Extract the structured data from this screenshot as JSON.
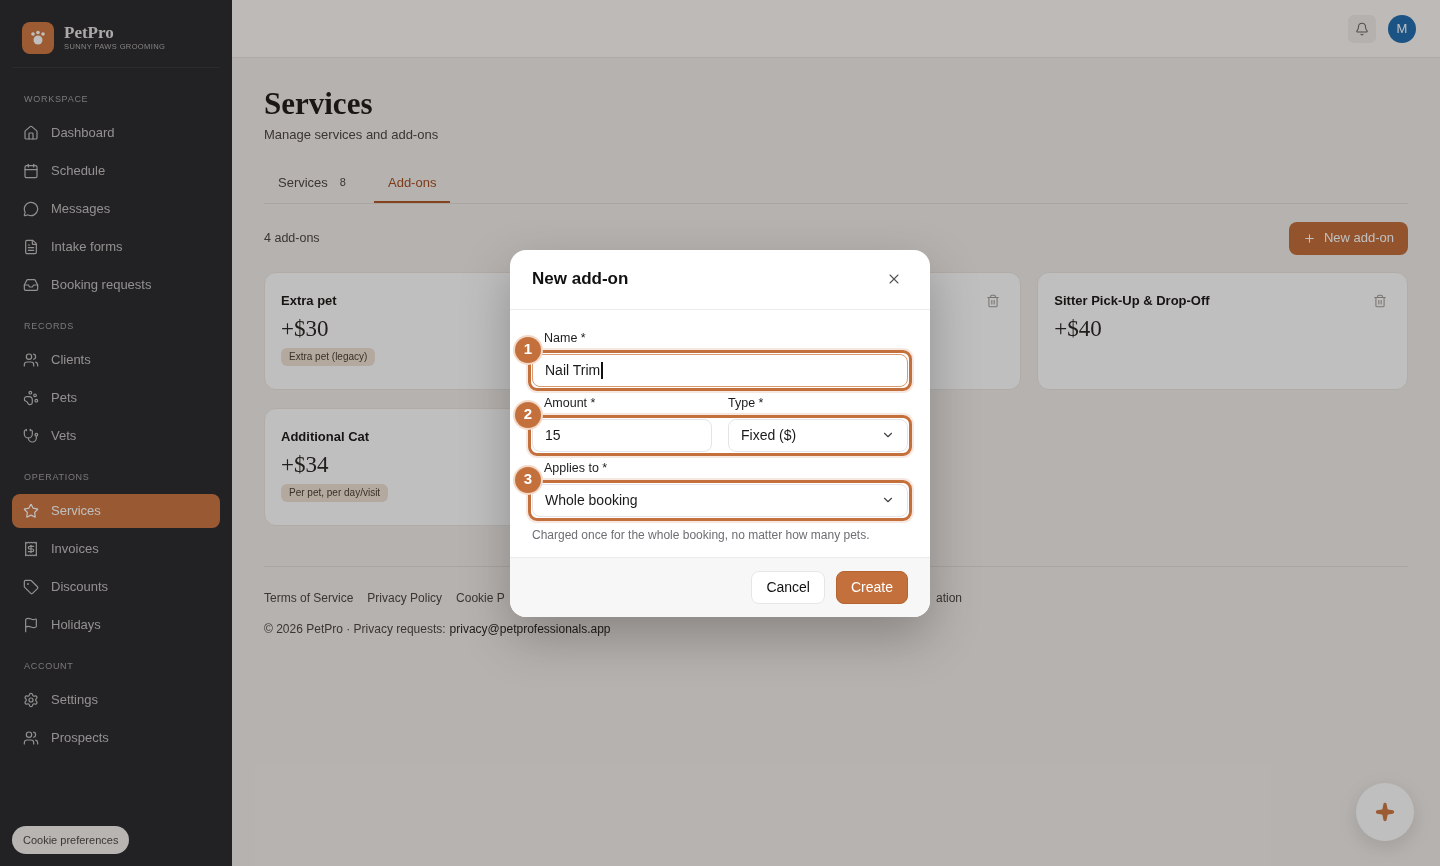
{
  "sidebar": {
    "brand": {
      "name": "PetPro",
      "subtitle": "SUNNY PAWS GROOMING"
    },
    "sections": [
      {
        "heading": "WORKSPACE",
        "items": [
          {
            "label": "Dashboard",
            "selected": false
          },
          {
            "label": "Schedule",
            "selected": false
          },
          {
            "label": "Messages",
            "selected": false
          },
          {
            "label": "Intake forms",
            "selected": false
          },
          {
            "label": "Booking requests",
            "selected": false
          }
        ]
      },
      {
        "heading": "RECORDS",
        "items": [
          {
            "label": "Clients",
            "selected": false
          },
          {
            "label": "Pets",
            "selected": false
          },
          {
            "label": "Vets",
            "selected": false
          }
        ]
      },
      {
        "heading": "OPERATIONS",
        "items": [
          {
            "label": "Services",
            "selected": true
          },
          {
            "label": "Invoices",
            "selected": false
          },
          {
            "label": "Discounts",
            "selected": false
          },
          {
            "label": "Holidays",
            "selected": false
          }
        ]
      },
      {
        "heading": "ACCOUNT",
        "items": [
          {
            "label": "Settings",
            "selected": false
          },
          {
            "label": "Prospects",
            "selected": false
          }
        ]
      }
    ],
    "cookie_button": "Cookie preferences"
  },
  "topbar": {
    "avatar": "M"
  },
  "page": {
    "title": "Services",
    "subtitle": "Manage services and add-ons"
  },
  "tabs": [
    {
      "label": "Services",
      "count": "8",
      "selected": false
    },
    {
      "label": "Add-ons",
      "selected": true
    }
  ],
  "toolbar": {
    "count": "4 add-ons",
    "button": "New add-on"
  },
  "cards": [
    {
      "title": "Extra pet",
      "price": "+$30",
      "tag": "Extra pet (legacy)"
    },
    {
      "deletable": true
    },
    {
      "title": "Sitter Pick-Up & Drop-Off",
      "price": "+$40",
      "deletable": true
    },
    {
      "title": "Additional Cat",
      "price": "+$34",
      "tag": "Per pet, per day/visit"
    }
  ],
  "footer": {
    "links": [
      "Terms of Service",
      "Privacy Policy",
      "Cookie P",
      "ation"
    ],
    "copyright": "© 2026 PetPro · Privacy requests:",
    "email": "privacy@petprofessionals.app"
  },
  "dialog": {
    "title": "New add-on",
    "sections": [
      {
        "callout": "1",
        "fields": [
          {
            "kind": "text",
            "label": "Name *",
            "value": "Nail Trim",
            "focused": true
          }
        ]
      },
      {
        "callout": "2",
        "fields": [
          {
            "kind": "text",
            "label": "Amount *",
            "value": "15",
            "focused": false
          },
          {
            "kind": "select",
            "label": "Type *",
            "value": "Fixed ($)"
          }
        ]
      },
      {
        "callout": "3",
        "fields": [
          {
            "kind": "select",
            "label": "Applies to *",
            "value": "Whole booking"
          }
        ]
      }
    ],
    "hint": "Charged once for the whole booking, no matter how many pets.",
    "buttons": [
      {
        "label": "Cancel",
        "kind": "secondary"
      },
      {
        "label": "Create",
        "kind": "primary"
      }
    ]
  }
}
